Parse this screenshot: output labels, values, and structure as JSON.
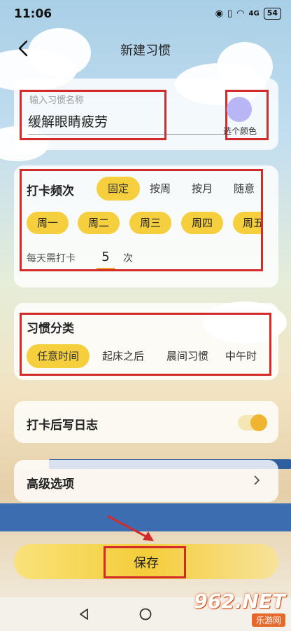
{
  "status_bar": {
    "time": "11:06",
    "signal_label": "4G",
    "battery": "54"
  },
  "header": {
    "title": "新建习惯"
  },
  "habit_name": {
    "placeholder": "输入习惯名称",
    "value": "缓解眼睛疲劳"
  },
  "color_picker": {
    "label": "选个颜色",
    "color": "#b9b6f5"
  },
  "frequency": {
    "label": "打卡频次",
    "modes": [
      "固定",
      "按周",
      "按月",
      "随意"
    ],
    "selected_mode": "固定",
    "days": [
      "周一",
      "周二",
      "周三",
      "周四",
      "周五"
    ],
    "daily_prefix": "每天需打卡",
    "daily_count": "5",
    "daily_unit": "次"
  },
  "category": {
    "label": "习惯分类",
    "options": [
      "任意时间",
      "起床之后",
      "晨间习惯",
      "中午时"
    ],
    "selected": "任意时间"
  },
  "journal": {
    "label": "打卡后写日志",
    "enabled": true
  },
  "advanced": {
    "label": "高级选项"
  },
  "save": {
    "label": "保存"
  },
  "watermark": {
    "big": "962.NET",
    "small": "乐游网"
  },
  "colors": {
    "accent": "#f6cf3f",
    "highlight": "#d32a2a",
    "toggle": "#f0b530"
  }
}
